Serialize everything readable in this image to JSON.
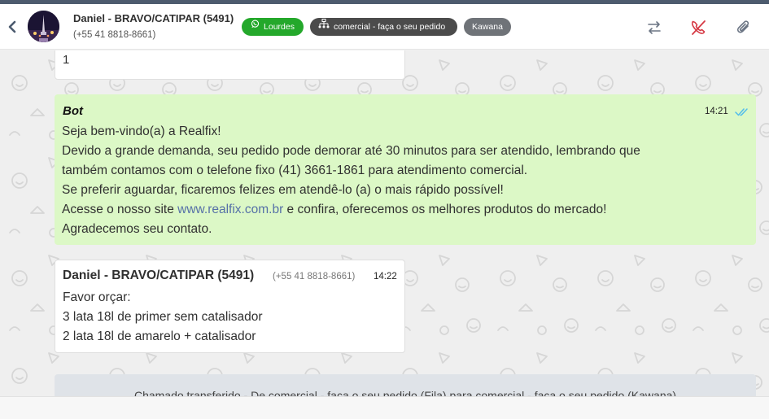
{
  "header": {
    "contact_name": "Daniel - BRAVO/CATIPAR (5491)",
    "contact_phone": "(+55 41 8818-8661)",
    "tags": [
      {
        "label": "Lourdes",
        "icon": "whatsapp-icon",
        "color": "#24a82b"
      },
      {
        "label": "comercial - faça o seu pedido",
        "icon": "org-chart-icon",
        "color": "#4b4b4b"
      },
      {
        "label": "Kawana",
        "color": "#6f7378"
      }
    ],
    "actions": [
      "transfer-icon",
      "end-call-icon",
      "attach-icon"
    ]
  },
  "messages": [
    {
      "text": "1"
    },
    {
      "author": "Bot",
      "time": "14:21",
      "lines": [
        "Seja bem-vindo(a) a Realfix!",
        "Devido a grande demanda, seu pedido pode demorar até 30 minutos para ser atendido, lembrando que",
        "também contamos com o telefone fixo (41) 3661-1861 para atendimento comercial.",
        "Se preferir aguardar, ficaremos felizes em atendê-lo (a) o mais rápido possível!"
      ],
      "link_prefix": "Acesse o nosso site ",
      "link": "www.realfix.com.br",
      "link_suffix": " e confira, oferecemos os melhores produtos do mercado!",
      "last_line": "Agradecemos seu contato."
    },
    {
      "author": "Daniel - BRAVO/CATIPAR (5491)",
      "phone": "(+55 41 8818-8661)",
      "time": "14:22",
      "lines": [
        "Favor orçar:",
        "3 lata 18l de primer sem catalisador",
        "2 lata 18l de amarelo + catalisador"
      ]
    }
  ],
  "system_message": "Chamado transferido - De comercial - faça o seu pedido (Fila) para comercial - faça o seu pedido (Kawana)",
  "colors": {
    "bot_bubble": "#dcf8c6",
    "tag_green": "#24a82b",
    "end_call": "#d63a45",
    "link": "#5570a7"
  }
}
